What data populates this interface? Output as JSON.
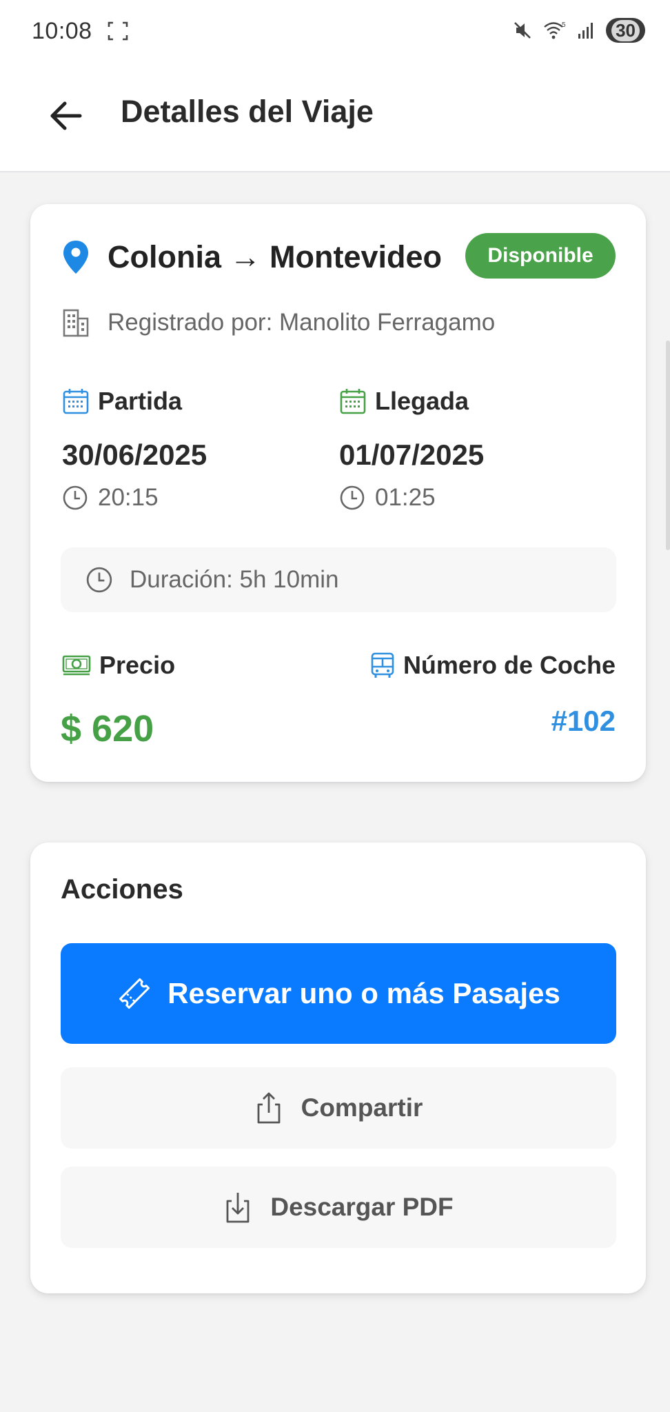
{
  "status_bar": {
    "time": "10:08",
    "battery": "30",
    "wifi_label": "5"
  },
  "header": {
    "title": "Detalles del Viaje"
  },
  "trip": {
    "route": "Colonia → Montevideo",
    "status": "Disponible",
    "registered_by": "Registrado por: Manolito Ferragamo",
    "departure": {
      "label": "Partida",
      "date": "30/06/2025",
      "time": "20:15"
    },
    "arrival": {
      "label": "Llegada",
      "date": "01/07/2025",
      "time": "01:25"
    },
    "duration": "Duración: 5h 10min",
    "price_label": "Precio",
    "price": "$ 620",
    "coach_label": "Número de Coche",
    "coach_number": "#102"
  },
  "actions": {
    "title": "Acciones",
    "reserve": "Reservar uno o más Pasajes",
    "share": "Compartir",
    "download": "Descargar PDF"
  },
  "colors": {
    "primary": "#0a7bff",
    "success": "#4aa24a",
    "price": "#46a046",
    "coach": "#2f8fe0",
    "departure_icon": "#2f8fe0",
    "arrival_icon": "#46a046"
  },
  "icons": {
    "back": "arrow-left-icon",
    "location": "map-pin-icon",
    "building": "building-icon",
    "calendar": "calendar-icon",
    "clock": "clock-icon",
    "money": "money-icon",
    "bus": "bus-icon",
    "ticket": "ticket-icon",
    "share": "share-icon",
    "download": "download-icon"
  }
}
